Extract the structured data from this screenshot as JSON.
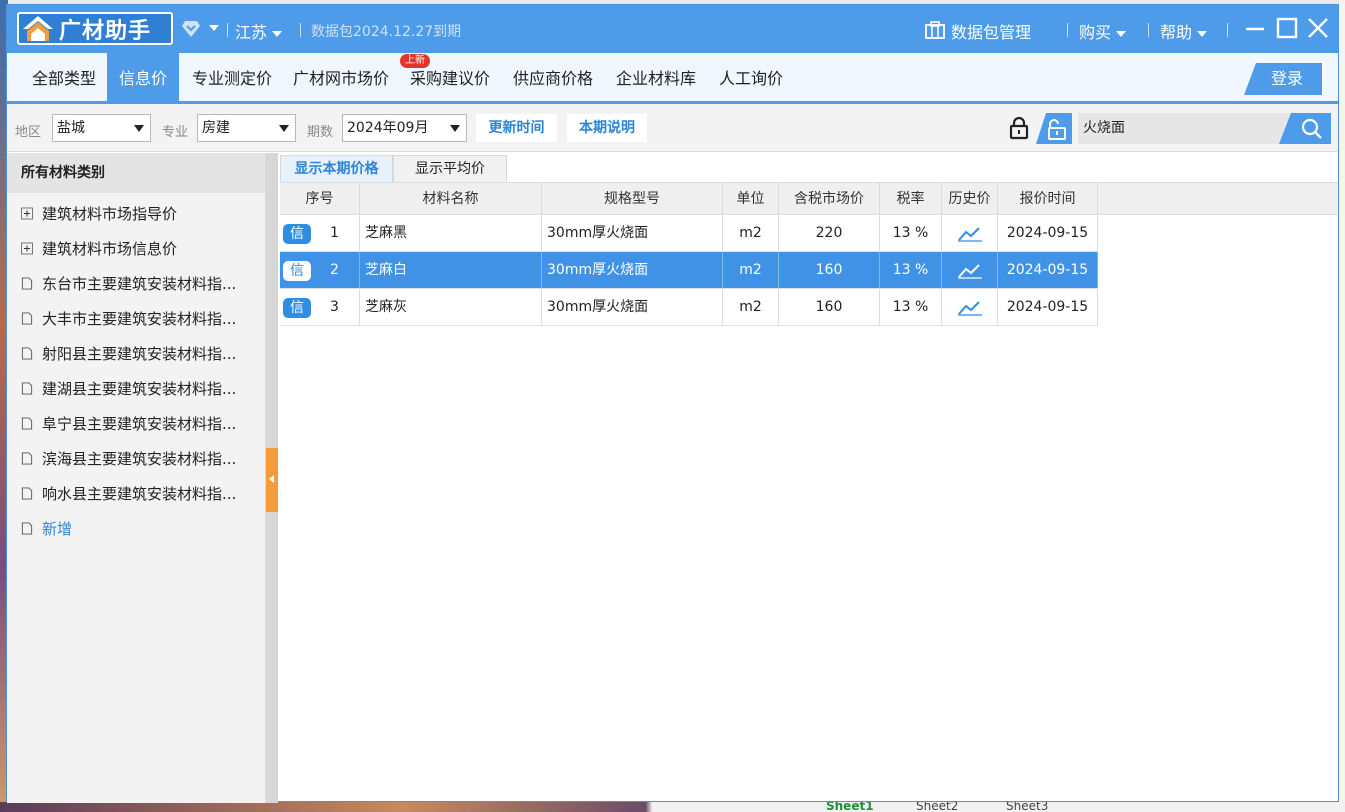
{
  "app": {
    "name": "广材助手",
    "region": "江苏",
    "package_expiry": "数据包2024.12.27到期",
    "package_manage": "数据包管理",
    "buy": "购买",
    "help": "帮助"
  },
  "nav": {
    "tabs": [
      {
        "label": "全部类型",
        "active": false
      },
      {
        "label": "信息价",
        "active": true
      },
      {
        "label": "专业测定价",
        "active": false
      },
      {
        "label": "广材网市场价",
        "active": false
      },
      {
        "label": "采购建议价",
        "active": false
      },
      {
        "label": "供应商价格",
        "active": false
      },
      {
        "label": "企业材料库",
        "active": false
      },
      {
        "label": "人工询价",
        "active": false
      }
    ],
    "new_badge": "上新",
    "login": "登录"
  },
  "filters": {
    "region_label": "地区",
    "region_value": "盐城",
    "major_label": "专业",
    "major_value": "房建",
    "period_label": "期数",
    "period_value": "2024年09月",
    "update_time_btn": "更新时间",
    "period_note_btn": "本期说明",
    "search_value": "火烧面"
  },
  "sidebar": {
    "header": "所有材料类别",
    "items": [
      {
        "label": "建筑材料市场指导价",
        "type": "expand"
      },
      {
        "label": "建筑材料市场信息价",
        "type": "expand"
      },
      {
        "label": "东台市主要建筑安装材料指...",
        "type": "doc"
      },
      {
        "label": "大丰市主要建筑安装材料指...",
        "type": "doc"
      },
      {
        "label": "射阳县主要建筑安装材料指...",
        "type": "doc"
      },
      {
        "label": "建湖县主要建筑安装材料指...",
        "type": "doc"
      },
      {
        "label": "阜宁县主要建筑安装材料指...",
        "type": "doc"
      },
      {
        "label": "滨海县主要建筑安装材料指...",
        "type": "doc"
      },
      {
        "label": "响水县主要建筑安装材料指...",
        "type": "doc"
      }
    ],
    "add_label": "新增"
  },
  "subtabs": [
    "显示本期价格",
    "显示平均价"
  ],
  "table": {
    "columns": [
      "序号",
      "材料名称",
      "规格型号",
      "单位",
      "含税市场价",
      "税率",
      "历史价",
      "报价时间"
    ],
    "tag": "信",
    "rows": [
      {
        "no": "1",
        "name": "芝麻黑",
        "spec": "30mm厚火烧面",
        "unit": "m2",
        "price": "220",
        "tax": "13 %",
        "date": "2024-09-15",
        "selected": false
      },
      {
        "no": "2",
        "name": "芝麻白",
        "spec": "30mm厚火烧面",
        "unit": "m2",
        "price": "160",
        "tax": "13 %",
        "date": "2024-09-15",
        "selected": true
      },
      {
        "no": "3",
        "name": "芝麻灰",
        "spec": "30mm厚火烧面",
        "unit": "m2",
        "price": "160",
        "tax": "13 %",
        "date": "2024-09-15",
        "selected": false
      }
    ]
  },
  "background": {
    "sheets": [
      "Sheet1",
      "Sheet2",
      "Sheet3"
    ]
  },
  "colors": {
    "brand": "#4d9be9",
    "selected_row": "#3f92e6",
    "badge": "#e5352b",
    "handle": "#f39c3a"
  }
}
